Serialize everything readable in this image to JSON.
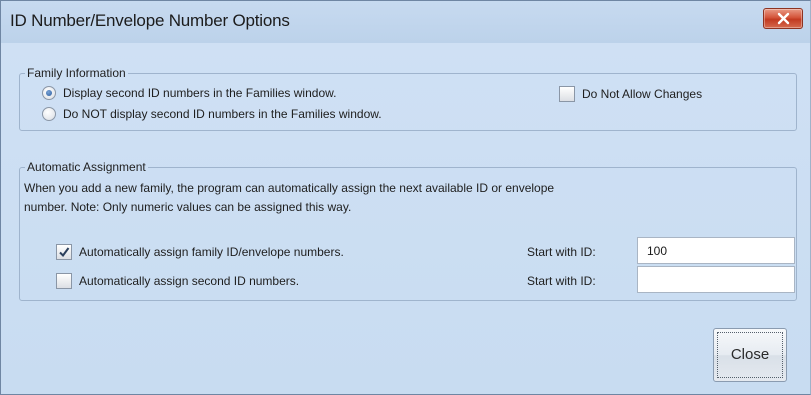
{
  "window": {
    "title": "ID Number/Envelope Number Options"
  },
  "family_info": {
    "legend": "Family Information",
    "radio_display": {
      "label": "Display second ID numbers in the Families window.",
      "selected": true
    },
    "radio_not_display": {
      "label": "Do NOT display second ID numbers in the Families window.",
      "selected": false
    },
    "no_changes": {
      "label": "Do Not Allow Changes",
      "checked": false
    }
  },
  "auto_assign": {
    "legend": "Automatic Assignment",
    "description_line1": "When you add a new family, the program can automatically assign the next available ID or envelope",
    "description_line2": "number. Note: Only numeric values can be assigned this way.",
    "family_id": {
      "label": "Automatically assign family ID/envelope numbers.",
      "checked": true,
      "start_label": "Start with ID:",
      "start_value": "100"
    },
    "second_id": {
      "label": "Automatically assign second ID numbers.",
      "checked": false,
      "start_label": "Start with ID:",
      "start_value": ""
    }
  },
  "buttons": {
    "close_label": "Close"
  }
}
